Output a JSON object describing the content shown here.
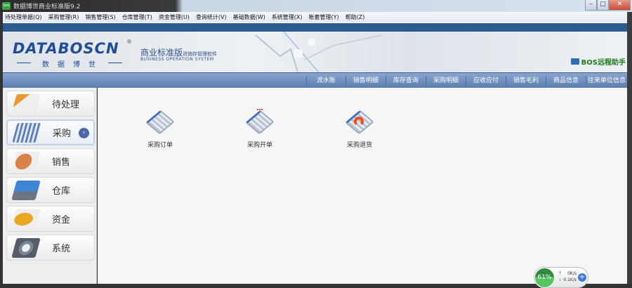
{
  "window": {
    "title": "数据博世商业标准版9.2",
    "app_icon": "bos",
    "controls": {
      "minimize": "–",
      "maximize": "□",
      "close": "✕"
    }
  },
  "menu": [
    "待处理单据(Q)",
    "采购管理(R)",
    "销售管理(S)",
    "仓库管理(T)",
    "资金管理(U)",
    "查询统计(V)",
    "基础数据(W)",
    "系统管理(X)",
    "帐套管理(Y)",
    "帮助(Z)"
  ],
  "banner": {
    "logo": "DATABOSCN",
    "logo_reg": "®",
    "logo_cn": "数据博世",
    "product": "商业标准版",
    "product_sub": "进销存管理软件",
    "product_en": "BUSINESS OPERATION SYSTEM",
    "remote": "BOS远程助手"
  },
  "nav": [
    "流水账",
    "销售明细",
    "库存查询",
    "采购明细",
    "应收应付",
    "销售毛利",
    "商品信息",
    "往来单位信息"
  ],
  "sidebar": [
    {
      "label": "待处理",
      "color": "#e89a30"
    },
    {
      "label": "采购",
      "color": "#5a7fc0",
      "active": true,
      "chevron": "›"
    },
    {
      "label": "销售",
      "color": "#d9824a"
    },
    {
      "label": "仓库",
      "color": "#3d86d6"
    },
    {
      "label": "资金",
      "color": "#e8a820"
    },
    {
      "label": "系统",
      "color": "#7a8694"
    }
  ],
  "functions": [
    {
      "label": "采购订单"
    },
    {
      "label": "采购开单"
    },
    {
      "label": "采购退货"
    }
  ],
  "net_widget": {
    "cpu": "61%",
    "up": "0K/s",
    "down": "0.1K/s",
    "up_arrow": "↑",
    "down_arrow": "↓",
    "plus": "+"
  }
}
